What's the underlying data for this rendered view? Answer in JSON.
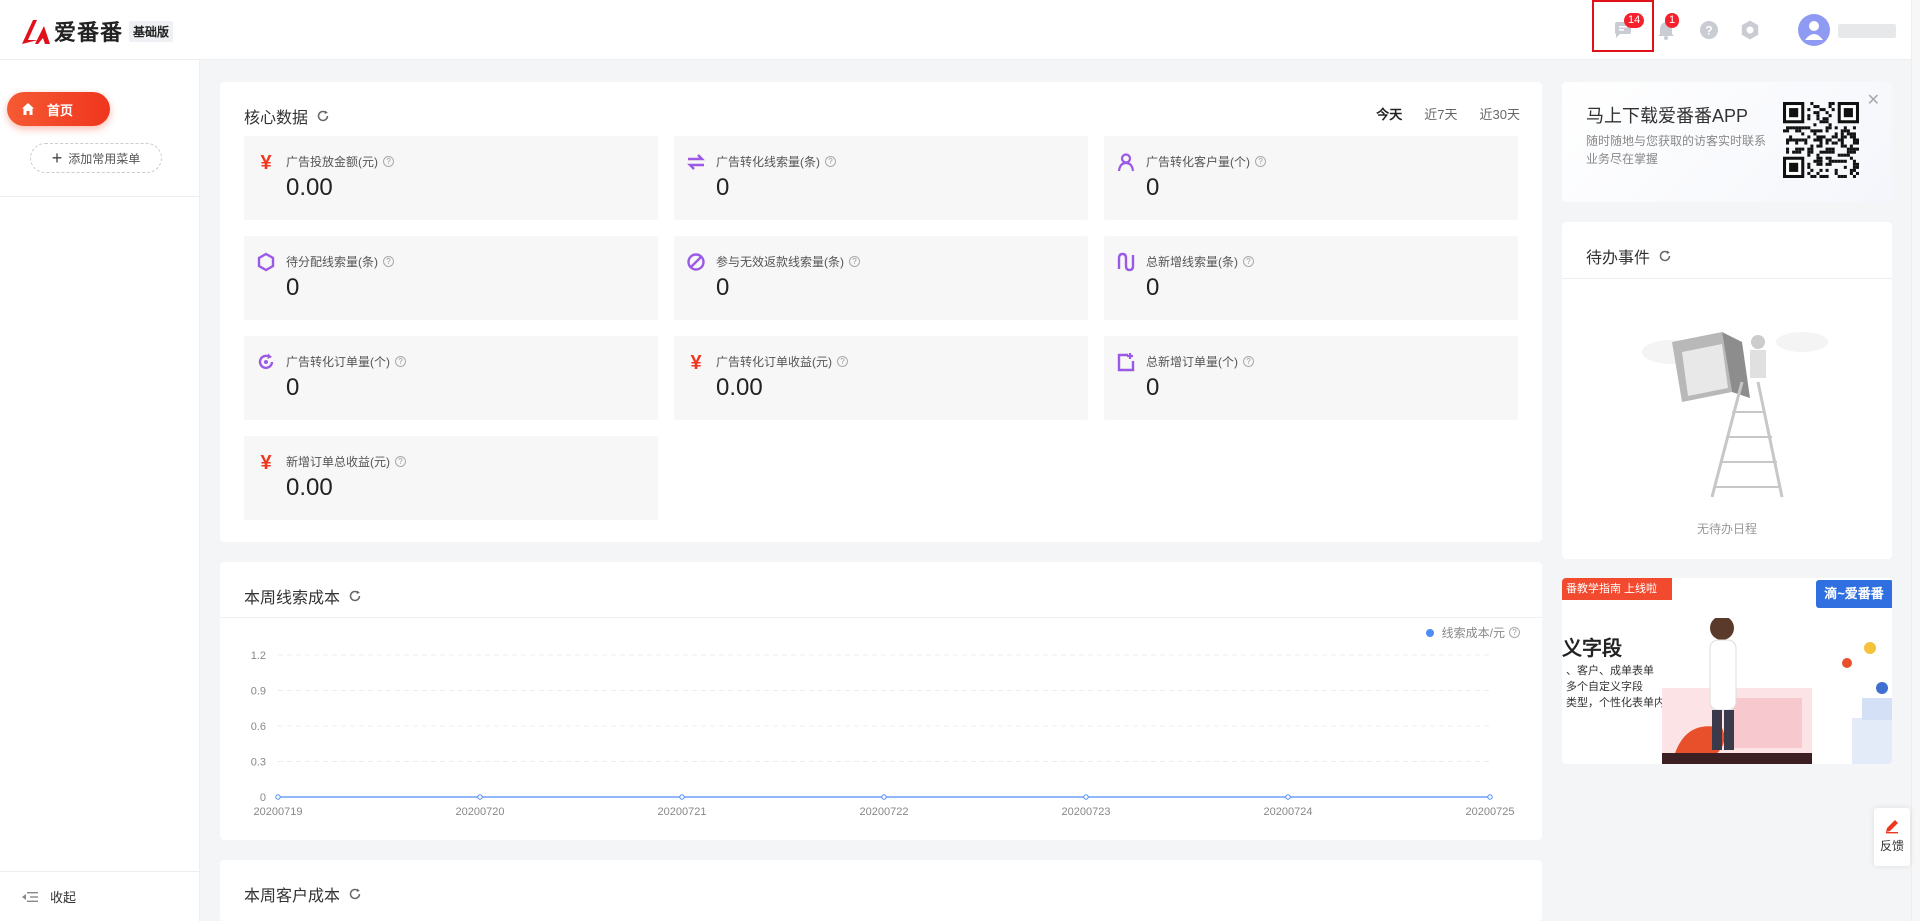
{
  "header": {
    "logo_text": "爱番番",
    "edition_badge": "基础版",
    "message_count": "14",
    "notification_count": "1"
  },
  "sidebar": {
    "home_label": "首页",
    "add_menu_label": "添加常用菜单",
    "collapse_label": "收起"
  },
  "core_data": {
    "title": "核心数据",
    "range_tabs": [
      "今天",
      "近7天",
      "近30天"
    ],
    "active_range": "今天",
    "stats": [
      {
        "label": "广告投放金额(元)",
        "value": "0.00",
        "icon": "yuan-icon"
      },
      {
        "label": "广告转化线索量(条)",
        "value": "0",
        "icon": "exchange-icon"
      },
      {
        "label": "广告转化客户量(个)",
        "value": "0",
        "icon": "user-icon"
      },
      {
        "label": "待分配线索量(条)",
        "value": "0",
        "icon": "ring-icon"
      },
      {
        "label": "参与无效返款线索量(条)",
        "value": "0",
        "icon": "forbidden-icon"
      },
      {
        "label": "总新增线索量(条)",
        "value": "0",
        "icon": "wave-icon"
      },
      {
        "label": "广告转化订单量(个)",
        "value": "0",
        "icon": "refresh-order-icon"
      },
      {
        "label": "广告转化订单收益(元)",
        "value": "0.00",
        "icon": "yuan-icon"
      },
      {
        "label": "总新增订单量(个)",
        "value": "0",
        "icon": "new-order-icon"
      },
      {
        "label": "新增订单总收益(元)",
        "value": "0.00",
        "icon": "yuan-icon"
      }
    ]
  },
  "weekly_lead_cost": {
    "title": "本周线索成本"
  },
  "weekly_customer_cost": {
    "title": "本周客户成本"
  },
  "chart_data": {
    "type": "line",
    "title": "本周线索成本",
    "x": [
      "20200719",
      "20200720",
      "20200721",
      "20200722",
      "20200723",
      "20200724",
      "20200725"
    ],
    "series": [
      {
        "name": "线索成本/元",
        "values": [
          0,
          0,
          0,
          0,
          0,
          0,
          0
        ]
      }
    ],
    "yticks": [
      "1.2",
      "0.9",
      "0.6",
      "0.3",
      "0"
    ],
    "ylim": [
      0,
      1.2
    ],
    "grid": true,
    "legend_position": "top-right",
    "color": "#4e8cf5"
  },
  "app_promo": {
    "title": "马上下载爱番番APP",
    "description": "随时随地与您获取的访客实时联系业务尽在掌握"
  },
  "todo": {
    "title": "待办事件",
    "empty_text": "无待办日程"
  },
  "banner": {
    "tag": "番教学指南 上线啦",
    "corner_tag": "滴~爱番番",
    "title": "义字段",
    "lines": [
      "、客户、成单表单",
      "多个自定义字段",
      "类型，个性化表单内容"
    ]
  },
  "feedback": {
    "label": "反馈"
  },
  "colors": {
    "accent": "#f0361e",
    "purple": "#9b59e8",
    "line_blue": "#4e8cf5"
  }
}
